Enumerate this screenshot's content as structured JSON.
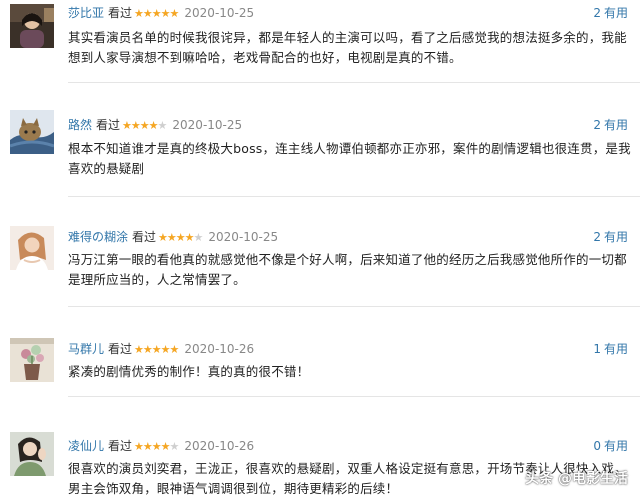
{
  "reviews": [
    {
      "author": "莎比亚",
      "watched": "看过",
      "stars": 5,
      "date": "2020-10-25",
      "useful_count": "2",
      "useful_label": "有用",
      "content": "其实看演员名单的时候我很诧异，都是年轻人的主演可以吗，看了之后感觉我的想法挺多余的，我能想到人家导演想不到嘛哈哈，老戏骨配合的也好，电视剧是真的不错。"
    },
    {
      "author": "路然",
      "watched": "看过",
      "stars": 4,
      "date": "2020-10-25",
      "useful_count": "2",
      "useful_label": "有用",
      "content": "根本不知道谁才是真的终极大boss，连主线人物谭伯顿都亦正亦邪，案件的剧情逻辑也很连贯，是我喜欢的悬疑剧"
    },
    {
      "author": "难得の糊涂",
      "watched": "看过",
      "stars": 4,
      "date": "2020-10-25",
      "useful_count": "2",
      "useful_label": "有用",
      "content": "冯万江第一眼的看他真的就感觉他不像是个好人啊，后来知道了他的经历之后我感觉他所作的一切都是理所应当的，人之常情罢了。"
    },
    {
      "author": "马群儿",
      "watched": "看过",
      "stars": 5,
      "date": "2020-10-26",
      "useful_count": "1",
      "useful_label": "有用",
      "content": "紧凑的剧情优秀的制作！真的真的很不错！"
    },
    {
      "author": "凌仙儿",
      "watched": "看过",
      "stars": 4,
      "date": "2020-10-26",
      "useful_count": "0",
      "useful_label": "有用",
      "content": "很喜欢的演员刘奕君，王泷正，很喜欢的悬疑剧，双重人格设定挺有意思，开场节奏让人很快入戏，男主会饰双角，眼神语气调调很到位，期待更精彩的后续！"
    }
  ],
  "watermark": "头条 @电影生活",
  "colors": {
    "link": "#3377aa",
    "star": "#f5a623",
    "star_empty": "#cfcfcf",
    "date": "#888888"
  },
  "icons": [
    "avatar-woman-icon",
    "avatar-cat-icon",
    "avatar-girl-icon",
    "avatar-flowers-icon",
    "avatar-woman-hand-icon"
  ]
}
